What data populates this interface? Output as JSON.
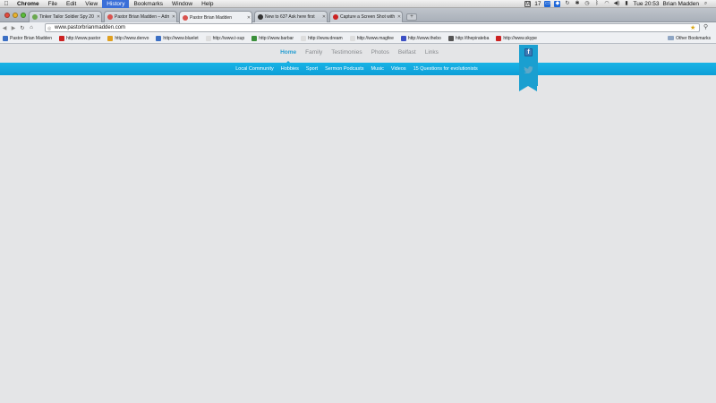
{
  "menubar": {
    "app": "Chrome",
    "items": [
      "File",
      "Edit",
      "View",
      "History",
      "Bookmarks",
      "Window",
      "Help"
    ],
    "active_item": "History",
    "status": {
      "battery_count": "17",
      "clock": "Tue 20:53",
      "user": "Brian Madden"
    }
  },
  "tabs": [
    {
      "title": "Tinker Tailor Soldier Spy 20",
      "color": "#6aa84f"
    },
    {
      "title": "Pastor Brian Madden – Adm",
      "color": "#d9534f"
    },
    {
      "title": "Pastor Brian Madden",
      "color": "#d9534f"
    },
    {
      "title": "New to 63? Ask here first",
      "color": "#333333"
    },
    {
      "title": "Capture a Screen Shot with",
      "color": "#cc2222"
    }
  ],
  "active_tab": 2,
  "toolbar": {
    "url": "www.pastorbrianmadden.com"
  },
  "bookmarks": [
    {
      "label": "Pastor Brian Madden",
      "color": "#3b6fc4"
    },
    {
      "label": "http://www.pastor",
      "color": "#cc2222"
    },
    {
      "label": "http://www.denvo",
      "color": "#e0a020"
    },
    {
      "label": "http://www.bluelet",
      "color": "#3b6fc4"
    },
    {
      "label": "http://www.t-sup",
      "color": "#dddddd"
    },
    {
      "label": "http://www.barbar",
      "color": "#3a8f3a"
    },
    {
      "label": "http://www.dream",
      "color": "#dddddd"
    },
    {
      "label": "http://www.magfee",
      "color": "#dddddd"
    },
    {
      "label": "http://www.thebo",
      "color": "#3b4fc4"
    },
    {
      "label": "http://thepirateba",
      "color": "#555555"
    },
    {
      "label": "http://www.skype",
      "color": "#cc2222"
    }
  ],
  "other_bookmarks": "Other Bookmarks",
  "site": {
    "main_nav": [
      "Home",
      "Family",
      "Testimonies",
      "Photos",
      "Belfast",
      "Links"
    ],
    "current": "Home",
    "sub_nav": [
      "Local Community",
      "Hobbies",
      "Sport",
      "Sermon Podcasts",
      "Music",
      "Videos",
      "15 Questions for evolutionists"
    ],
    "accent": "#1aa5d9"
  }
}
